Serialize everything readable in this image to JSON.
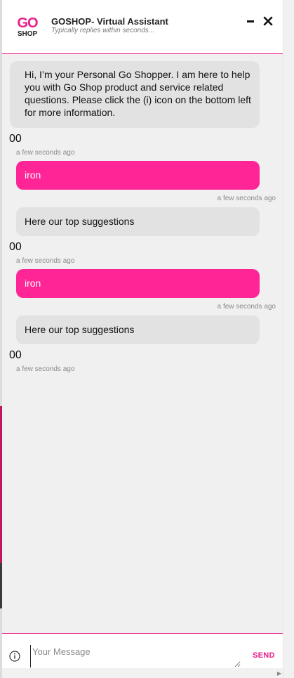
{
  "header": {
    "logo_top": "GO",
    "logo_bottom": "SHOP",
    "title": "GOSHOP- Virtual Assistant",
    "subtitle": "Typically replies within seconds...",
    "minimize_icon": "minus-icon",
    "close_icon": "close-icon"
  },
  "messages": [
    {
      "from": "bot",
      "text": "Hi, I’m your Personal Go Shopper. I am here to help you with Go Shop product and service related questions. Please click the (i) icon on the bottom left for more information."
    },
    {
      "from": "bot",
      "text": "00",
      "time": "a few seconds ago"
    },
    {
      "from": "user",
      "text": "iron",
      "time": "a few seconds ago"
    },
    {
      "from": "bot",
      "text": "Here our top suggestions"
    },
    {
      "from": "bot",
      "text": "00",
      "time": "a few seconds ago"
    },
    {
      "from": "user",
      "text": "iron",
      "time": "a few seconds ago"
    },
    {
      "from": "bot",
      "text": "Here our top suggestions"
    },
    {
      "from": "bot",
      "text": "00",
      "time": "a few seconds ago"
    }
  ],
  "footer": {
    "info_icon": "info-icon",
    "input_placeholder": "Your Message",
    "send_label": "SEND"
  },
  "colors": {
    "accent": "#e91e8c",
    "user_bubble": "#ff2596",
    "bot_bubble": "#e2e2e2",
    "chat_bg": "#f0f0f0"
  }
}
